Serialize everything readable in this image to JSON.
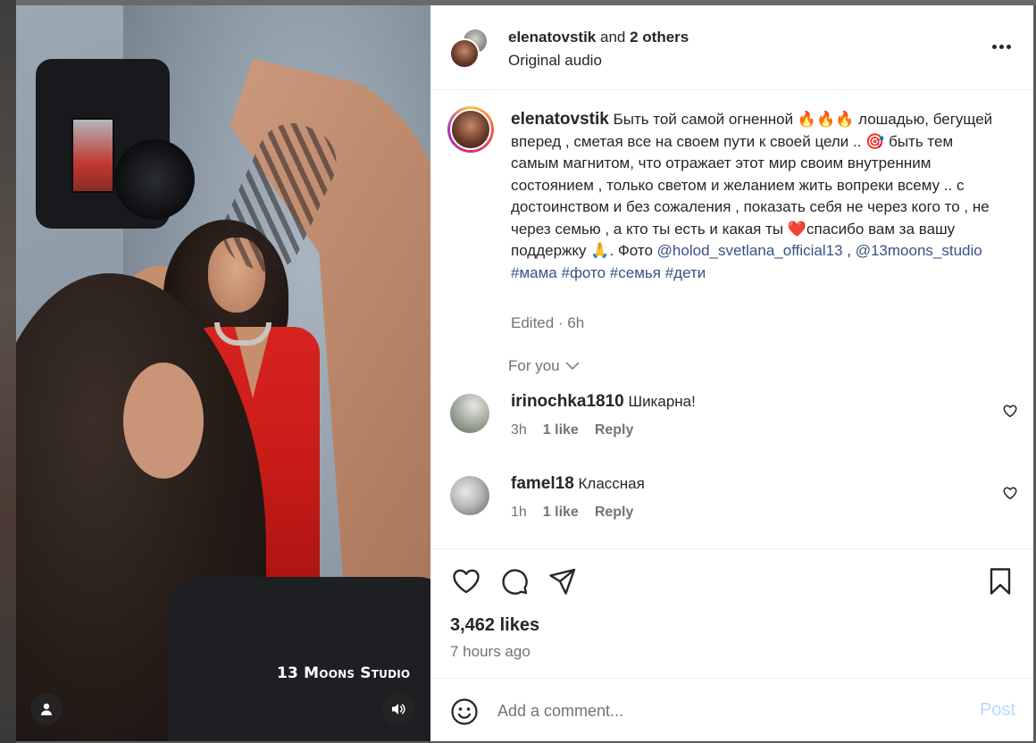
{
  "header": {
    "username": "elenatovstik",
    "and_text": "and",
    "others": "2 others",
    "audio": "Original audio"
  },
  "media": {
    "watermark": "13 Moons Studio",
    "user_icon": "person-icon",
    "audio_icon": "speaker-icon"
  },
  "caption": {
    "username": "elenatovstik",
    "text_1": "Быть той самой огненной ",
    "fire_emoji": "🔥🔥🔥",
    "text_2": " лошадью, бегущей вперед , сметая все на своем пути к своей цели .. ",
    "target_emoji": "🎯",
    "text_3": " быть тем самым магнитом, что отражает этот мир своим внутренним состоянием , только светом и желанием жить вопреки всему .. с достоинством и без сожаления , показать себя не через кого то , не через семью , а кто ты есть и какая ты ",
    "heart_emoji": "❤️",
    "text_4": "спасибо вам за вашу поддержку ",
    "pray_emoji": "🙏",
    "text_5": ". Фото ",
    "mention_1": "@holod_svetlana_official13",
    "sep": " , ",
    "mention_2": "@13moons_studio",
    "tags": [
      "#мама",
      "#фото",
      "#семья",
      "#дети"
    ],
    "meta": "Edited · 6h"
  },
  "for_you": "For you",
  "comments": [
    {
      "user": "irinochka1810",
      "text": "Шикарна!",
      "time": "3h",
      "likes": "1 like",
      "reply": "Reply"
    },
    {
      "user": "famel18",
      "text": "Классная",
      "time": "1h",
      "likes": "1 like",
      "reply": "Reply"
    }
  ],
  "actions": {
    "likes": "3,462 likes",
    "time_ago": "7 hours ago"
  },
  "composer": {
    "placeholder": "Add a comment...",
    "post_label": "Post"
  },
  "colors": {
    "link": "#385185",
    "post_disabled": "#b3dbff",
    "muted": "#737373"
  }
}
